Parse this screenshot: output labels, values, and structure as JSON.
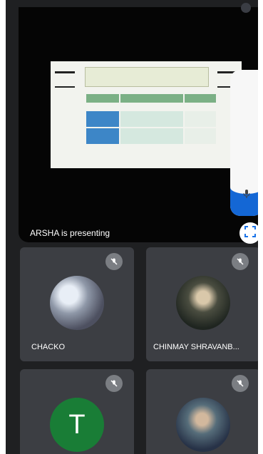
{
  "presentation": {
    "status_text": "ARSHA is presenting",
    "expand_icon": "fullscreen-icon",
    "slide_title": "",
    "share_level": 0.24
  },
  "participants": [
    {
      "name": "CHACKO",
      "avatar": "photo",
      "muted": true
    },
    {
      "name": "CHINMAY SHRAVANB...",
      "avatar": "photo",
      "muted": true
    },
    {
      "name": "",
      "avatar_initial": "T",
      "avatar_color": "#197d36",
      "muted": true
    },
    {
      "name": "",
      "avatar": "photo",
      "muted": true
    }
  ],
  "colors": {
    "background": "#1f2022",
    "tile": "#3c3e43",
    "accent": "#1a73e8",
    "mic_off": "#7b7e83"
  }
}
